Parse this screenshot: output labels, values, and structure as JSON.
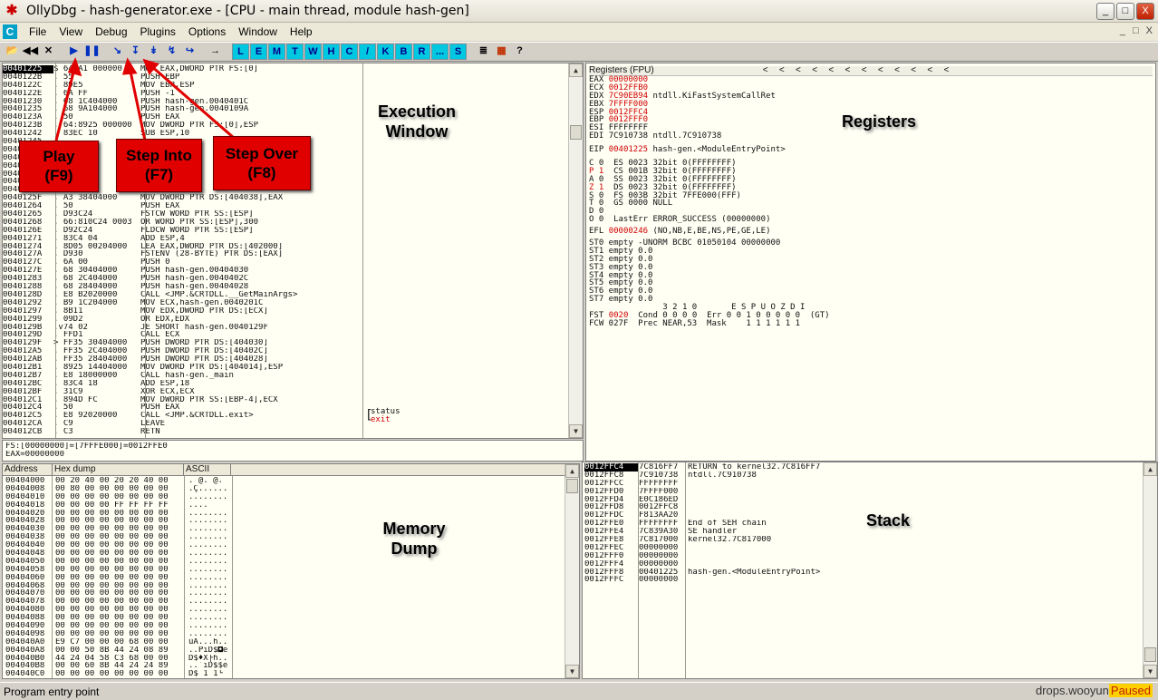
{
  "window": {
    "title": "OllyDbg - hash-generator.exe - [CPU - main thread, module hash-gen]",
    "minimize": "_",
    "maximize": "□",
    "close": "X"
  },
  "menu": [
    "File",
    "View",
    "Debug",
    "Plugins",
    "Options",
    "Window",
    "Help"
  ],
  "mdi": [
    "_",
    "□",
    "X"
  ],
  "toolbar": {
    "left": [
      "📂",
      "◀◀",
      "✕",
      "▶",
      "❚❚",
      "↘",
      "↧",
      "↡",
      "↯",
      "↪",
      "→"
    ],
    "letters": [
      "L",
      "E",
      "M",
      "T",
      "W",
      "H",
      "C",
      "/",
      "K",
      "B",
      "R",
      "...",
      "S"
    ],
    "right": [
      "≣",
      "▦",
      "?"
    ]
  },
  "labels": {
    "execution": "Execution\nWindow",
    "registers": "Registers",
    "memory": "Memory\nDump",
    "stack": "Stack"
  },
  "callouts": {
    "play": "Play\n(F9)",
    "step_into": "Step Into\n(F7)",
    "step_over": "Step Over\n(F8)"
  },
  "cpu_rows": [
    [
      "00401225",
      "$ 64:A1 000000",
      "MOV EAX,DWORD PTR FS:[0]"
    ],
    [
      "0040122B",
      ". 55",
      "PUSH EBP"
    ],
    [
      "0040122C",
      ". 89E5",
      "MOV EBP,ESP"
    ],
    [
      "0040122E",
      ". 6A FF",
      "PUSH -1"
    ],
    [
      "00401230",
      ". 68 1C404000",
      "PUSH hash-gen.0040401C"
    ],
    [
      "00401235",
      ". 68 9A104000",
      "PUSH hash-gen.0040109A"
    ],
    [
      "0040123A",
      ". 50",
      "PUSH EAX"
    ],
    [
      "0040123B",
      ". 64:8925 000000",
      "MOV DWORD PTR FS:[0],ESP"
    ],
    [
      "00401242",
      ". 83EC 10",
      "SUB ESP,10"
    ],
    [
      "00401245",
      "",
      ""
    ],
    [
      "00401246",
      "",
      ""
    ],
    [
      "00401247",
      "",
      ""
    ],
    [
      "0040124C",
      "",
      ""
    ],
    [
      "00401250",
      "",
      ""
    ],
    [
      "00401252",
      "",
      ""
    ],
    [
      "00401257",
      "",
      ""
    ],
    [
      "0040125F",
      ". A3 38404000",
      "MOV DWORD PTR DS:[404038],EAX"
    ],
    [
      "00401264",
      ". 50",
      "PUSH EAX"
    ],
    [
      "00401265",
      ". D93C24",
      "FSTCW WORD PTR SS:[ESP]"
    ],
    [
      "00401268",
      ". 66:810C24 0003",
      "OR WORD PTR SS:[ESP],300"
    ],
    [
      "0040126E",
      ". D92C24",
      "FLDCW WORD PTR SS:[ESP]"
    ],
    [
      "00401271",
      ". 83C4 04",
      "ADD ESP,4"
    ],
    [
      "00401274",
      ". 8D05 00204000",
      "LEA EAX,DWORD PTR DS:[402000]"
    ],
    [
      "0040127A",
      ". D930",
      "FSTENV (28-BYTE) PTR DS:[EAX]"
    ],
    [
      "0040127C",
      ". 6A 00",
      "PUSH 0"
    ],
    [
      "0040127E",
      ". 68 30404000",
      "PUSH hash-gen.00404030"
    ],
    [
      "00401283",
      ". 68 2C404000",
      "PUSH hash-gen.0040402C"
    ],
    [
      "00401288",
      ". 68 28404000",
      "PUSH hash-gen.00404028"
    ],
    [
      "0040128D",
      ". E8 B2020000",
      "CALL <JMP.&CRTDLL.__GetMainArgs>"
    ],
    [
      "00401292",
      ". B9 1C204000",
      "MOV ECX,hash-gen.0040201C"
    ],
    [
      "00401297",
      ". 8B11",
      "MOV EDX,DWORD PTR DS:[ECX]"
    ],
    [
      "00401299",
      ". 09D2",
      "OR EDX,EDX"
    ],
    [
      "0040129B",
      ".v74 02",
      "JE SHORT hash-gen.0040129F"
    ],
    [
      "0040129D",
      ". FFD1",
      "CALL ECX"
    ],
    [
      "0040129F",
      "> FF35 30404000",
      "PUSH DWORD PTR DS:[404030]"
    ],
    [
      "004012A5",
      ". FF35 2C404000",
      "PUSH DWORD PTR DS:[40402C]"
    ],
    [
      "004012AB",
      ". FF35 28404000",
      "PUSH DWORD PTR DS:[404028]"
    ],
    [
      "004012B1",
      ". 8925 14404000",
      "MOV DWORD PTR DS:[404014],ESP"
    ],
    [
      "004012B7",
      ". E8 18000000",
      "CALL hash-gen._main"
    ],
    [
      "004012BC",
      ". 83C4 18",
      "ADD ESP,18"
    ],
    [
      "004012BF",
      ". 31C9",
      "XOR ECX,ECX"
    ],
    [
      "004012C1",
      ". 894D FC",
      "MOV DWORD PTR SS:[EBP-4],ECX"
    ],
    [
      "004012C4",
      ". 50",
      "PUSH EAX"
    ],
    [
      "004012C5",
      ". E8 92020000",
      "CALL <JMP.&CRTDLL.exit>"
    ],
    [
      "004012CA",
      ". C9",
      "LEAVE"
    ],
    [
      "004012CB",
      ". C3",
      "RETN"
    ]
  ],
  "cpu_partial": {
    "r9": "PTR",
    "r10": "PTR",
    "r10b": "-gen.0040",
    "r11": "PTR",
    "r12": "PTR"
  },
  "comment": {
    "status": "status",
    "exit": "exit"
  },
  "info": [
    "FS:[00000000]=[7FFFE000]=0012FFE0",
    "EAX=00000000"
  ],
  "registers": {
    "header": "Registers (FPU)",
    "arrows": "<   <   <   <   <   <   <   <   <   <   <   <",
    "gp": [
      [
        "EAX",
        "00000000",
        ""
      ],
      [
        "ECX",
        "0012FFB0",
        ""
      ],
      [
        "EDX",
        "7C90EB94",
        "ntdll.KiFastSystemCallRet"
      ],
      [
        "EBX",
        "7FFFF000",
        ""
      ],
      [
        "ESP",
        "0012FFC4",
        ""
      ],
      [
        "EBP",
        "0012FFF0",
        ""
      ],
      [
        "ESI",
        "FFFFFFFF",
        ""
      ],
      [
        "EDI",
        "7C910738",
        "ntdll.7C910738"
      ]
    ],
    "eip": [
      "EIP",
      "00401225",
      "hash-gen.<ModuleEntryPoint>"
    ],
    "flags": [
      [
        "C 0",
        "ES 0023 32bit 0(FFFFFFFF)"
      ],
      [
        "P 1",
        "CS 001B 32bit 0(FFFFFFFF)"
      ],
      [
        "A 0",
        "SS 0023 32bit 0(FFFFFFFF)"
      ],
      [
        "Z 1",
        "DS 0023 32bit 0(FFFFFFFF)"
      ],
      [
        "S 0",
        "FS 003B 32bit 7FFE000(FFF)"
      ],
      [
        "T 0",
        "GS 0000 NULL"
      ],
      [
        "D 0",
        ""
      ],
      [
        "O 0",
        "LastErr ERROR_SUCCESS (00000000)"
      ]
    ],
    "efl": [
      "EFL",
      "00000246",
      "(NO,NB,E,BE,NS,PE,GE,LE)"
    ],
    "st": [
      "ST0 empty -UNORM BCBC 01050104 00000000",
      "ST1 empty 0.0",
      "ST2 empty 0.0",
      "ST3 empty 0.0",
      "ST4 empty 0.0",
      "ST5 empty 0.0",
      "ST6 empty 0.0",
      "ST7 empty 0.0"
    ],
    "bits": "               3 2 1 0       E S P U O Z D I",
    "fst": [
      "FST",
      "0020",
      "Cond 0 0 0 0  Err 0 0 1 0 0 0 0 0  (GT)"
    ],
    "fcw": "FCW 027F  Prec NEAR,53  Mask    1 1 1 1 1 1"
  },
  "dump": {
    "headers": [
      "Address",
      "Hex dump",
      "ASCII"
    ],
    "rows": [
      [
        "00404000",
        "00 20 40 00 20 20 40 00",
        ". @. @."
      ],
      [
        "00404008",
        "00 80 00 00 00 00 00 00",
        ".Ç......"
      ],
      [
        "00404010",
        "00 00 00 00 00 00 00 00",
        "........"
      ],
      [
        "00404018",
        "00 00 00 00 FF FF FF FF",
        "....    "
      ],
      [
        "00404020",
        "00 00 00 00 00 00 00 00",
        "........"
      ],
      [
        "00404028",
        "00 00 00 00 00 00 00 00",
        "........"
      ],
      [
        "00404030",
        "00 00 00 00 00 00 00 00",
        "........"
      ],
      [
        "00404038",
        "00 00 00 00 00 00 00 00",
        "........"
      ],
      [
        "00404040",
        "00 00 00 00 00 00 00 00",
        "........"
      ],
      [
        "00404048",
        "00 00 00 00 00 00 00 00",
        "........"
      ],
      [
        "00404050",
        "00 00 00 00 00 00 00 00",
        "........"
      ],
      [
        "00404058",
        "00 00 00 00 00 00 00 00",
        "........"
      ],
      [
        "00404060",
        "00 00 00 00 00 00 00 00",
        "........"
      ],
      [
        "00404068",
        "00 00 00 00 00 00 00 00",
        "........"
      ],
      [
        "00404070",
        "00 00 00 00 00 00 00 00",
        "........"
      ],
      [
        "00404078",
        "00 00 00 00 00 00 00 00",
        "........"
      ],
      [
        "00404080",
        "00 00 00 00 00 00 00 00",
        "........"
      ],
      [
        "00404088",
        "00 00 00 00 00 00 00 00",
        "........"
      ],
      [
        "00404090",
        "00 00 00 00 00 00 00 00",
        "........"
      ],
      [
        "00404098",
        "00 00 00 00 00 00 00 00",
        "........"
      ],
      [
        "004040A0",
        "E9 C7 00 00 00 68 00 00",
        "ûÃ...h.."
      ],
      [
        "004040A8",
        "00 00 50 8B 44 24 08 89",
        "..PïD$◘ë"
      ],
      [
        "004040B0",
        "44 24 04 58 C3 68 00 00",
        "D$♦X├h.."
      ],
      [
        "004040B8",
        "00 00 60 8B 44 24 24 89",
        "..`ïD$$ë"
      ],
      [
        "004040C0",
        "00 00 00 00 00 00 00 00",
        "D$ 1 1└"
      ]
    ]
  },
  "stack": {
    "rows": [
      [
        "0012FFC4",
        "7C816FF7",
        "RETURN to kernel32.7C816FF7"
      ],
      [
        "0012FFC8",
        "7C910738",
        "ntdll.7C910738"
      ],
      [
        "0012FFCC",
        "FFFFFFFF",
        ""
      ],
      [
        "0012FFD0",
        "7FFFF000",
        ""
      ],
      [
        "0012FFD4",
        "E0C186ED",
        ""
      ],
      [
        "0012FFD8",
        "0012FFC8",
        ""
      ],
      [
        "0012FFDC",
        "F813AA20",
        ""
      ],
      [
        "0012FFE0",
        "FFFFFFFF",
        "End of SEH chain"
      ],
      [
        "0012FFE4",
        "7C839A30",
        "SE handler"
      ],
      [
        "0012FFE8",
        "7C817000",
        "kernel32.7C817000"
      ],
      [
        "0012FFEC",
        "00000000",
        ""
      ],
      [
        "0012FFF0",
        "00000000",
        ""
      ],
      [
        "0012FFF4",
        "00000000",
        ""
      ],
      [
        "0012FFF8",
        "00401225",
        "hash-gen.<ModuleEntryPoint>"
      ],
      [
        "0012FFFC",
        "00000000",
        ""
      ]
    ]
  },
  "status": {
    "message": "Program entry point",
    "watermark1": "drops.wooyun",
    "watermark2": "Paused"
  }
}
